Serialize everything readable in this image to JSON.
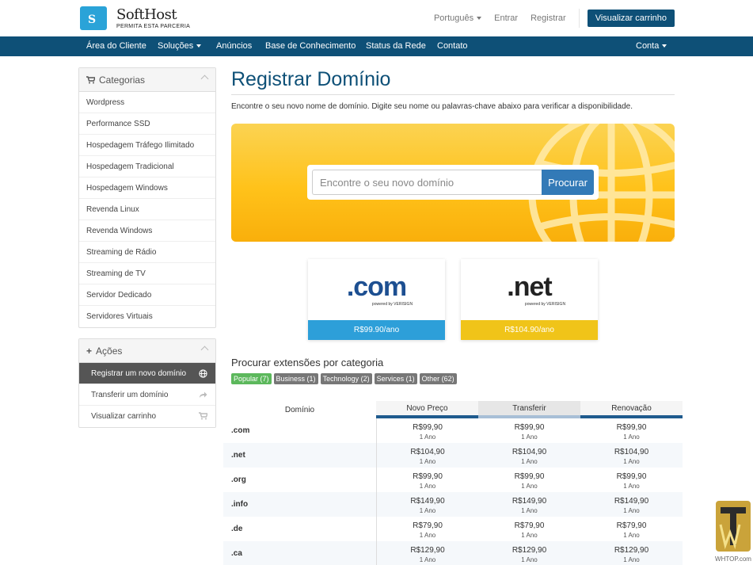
{
  "brand": {
    "name": "SoftHost",
    "tagline": "PERMITA ESTA PARCERIA"
  },
  "top_links": {
    "language": "Português",
    "login": "Entrar",
    "register": "Registrar",
    "cart_button": "Visualizar carrinho"
  },
  "nav": {
    "items": [
      "Área do Cliente",
      "Soluções",
      "Anúncios",
      "Base de Conhecimento",
      "Status da Rede",
      "Contato"
    ],
    "account": "Conta"
  },
  "sidebar": {
    "categories_title": "Categorias",
    "categories": [
      "Wordpress",
      "Performance SSD",
      "Hospedagem Tráfego Ilimitado",
      "Hospedagem Tradicional",
      "Hospedagem Windows",
      "Revenda Linux",
      "Revenda Windows",
      "Streaming de Rádio",
      "Streaming de TV",
      "Servidor Dedicado",
      "Servidores Virtuais"
    ],
    "actions_title": "Ações",
    "actions": [
      {
        "label": "Registrar um novo domínio",
        "icon": "globe-icon",
        "active": true
      },
      {
        "label": "Transferir um domínio",
        "icon": "share-icon",
        "active": false
      },
      {
        "label": "Visualizar carrinho",
        "icon": "cart-icon",
        "active": false
      }
    ]
  },
  "main": {
    "title": "Registrar Domínio",
    "intro": "Encontre o seu novo nome de domínio. Digite seu nome ou palavras-chave abaixo para verificar a disponibilidade.",
    "search": {
      "placeholder": "Encontre o seu novo domínio",
      "button": "Procurar"
    }
  },
  "featured": [
    {
      "tld": ".com",
      "powered": "powered by VERISIGN",
      "price": "R$99.90/ano",
      "color": "#2d9fd9"
    },
    {
      "tld": ".net",
      "powered": "powered by VERISIGN",
      "price": "R$104.90/ano",
      "color": "#f0c419"
    }
  ],
  "categories_section": {
    "title": "Procurar extensões por categoria",
    "tags": [
      "Popular (7)",
      "Business (1)",
      "Technology (2)",
      "Services (1)",
      "Other (62)"
    ]
  },
  "pricing_table": {
    "headers": [
      "Domínio",
      "Novo Preço",
      "Transferir",
      "Renovação"
    ],
    "period": "1 Ano",
    "rows": [
      {
        "tld": ".com",
        "new": "R$99,90",
        "transfer": "R$99,90",
        "renew": "R$99,90"
      },
      {
        "tld": ".net",
        "new": "R$104,90",
        "transfer": "R$104,90",
        "renew": "R$104,90"
      },
      {
        "tld": ".org",
        "new": "R$99,90",
        "transfer": "R$99,90",
        "renew": "R$99,90"
      },
      {
        "tld": ".info",
        "new": "R$149,90",
        "transfer": "R$149,90",
        "renew": "R$149,90"
      },
      {
        "tld": ".de",
        "new": "R$79,90",
        "transfer": "R$79,90",
        "renew": "R$79,90"
      },
      {
        "tld": ".ca",
        "new": "R$129,90",
        "transfer": "R$129,90",
        "renew": "R$129,90"
      }
    ]
  },
  "watermark": {
    "text": "WHTOP.com"
  },
  "colors": {
    "primary": "#0e5077",
    "accent": "#337ab7",
    "hero": "#ffc21a",
    "success": "#5cb85c"
  }
}
